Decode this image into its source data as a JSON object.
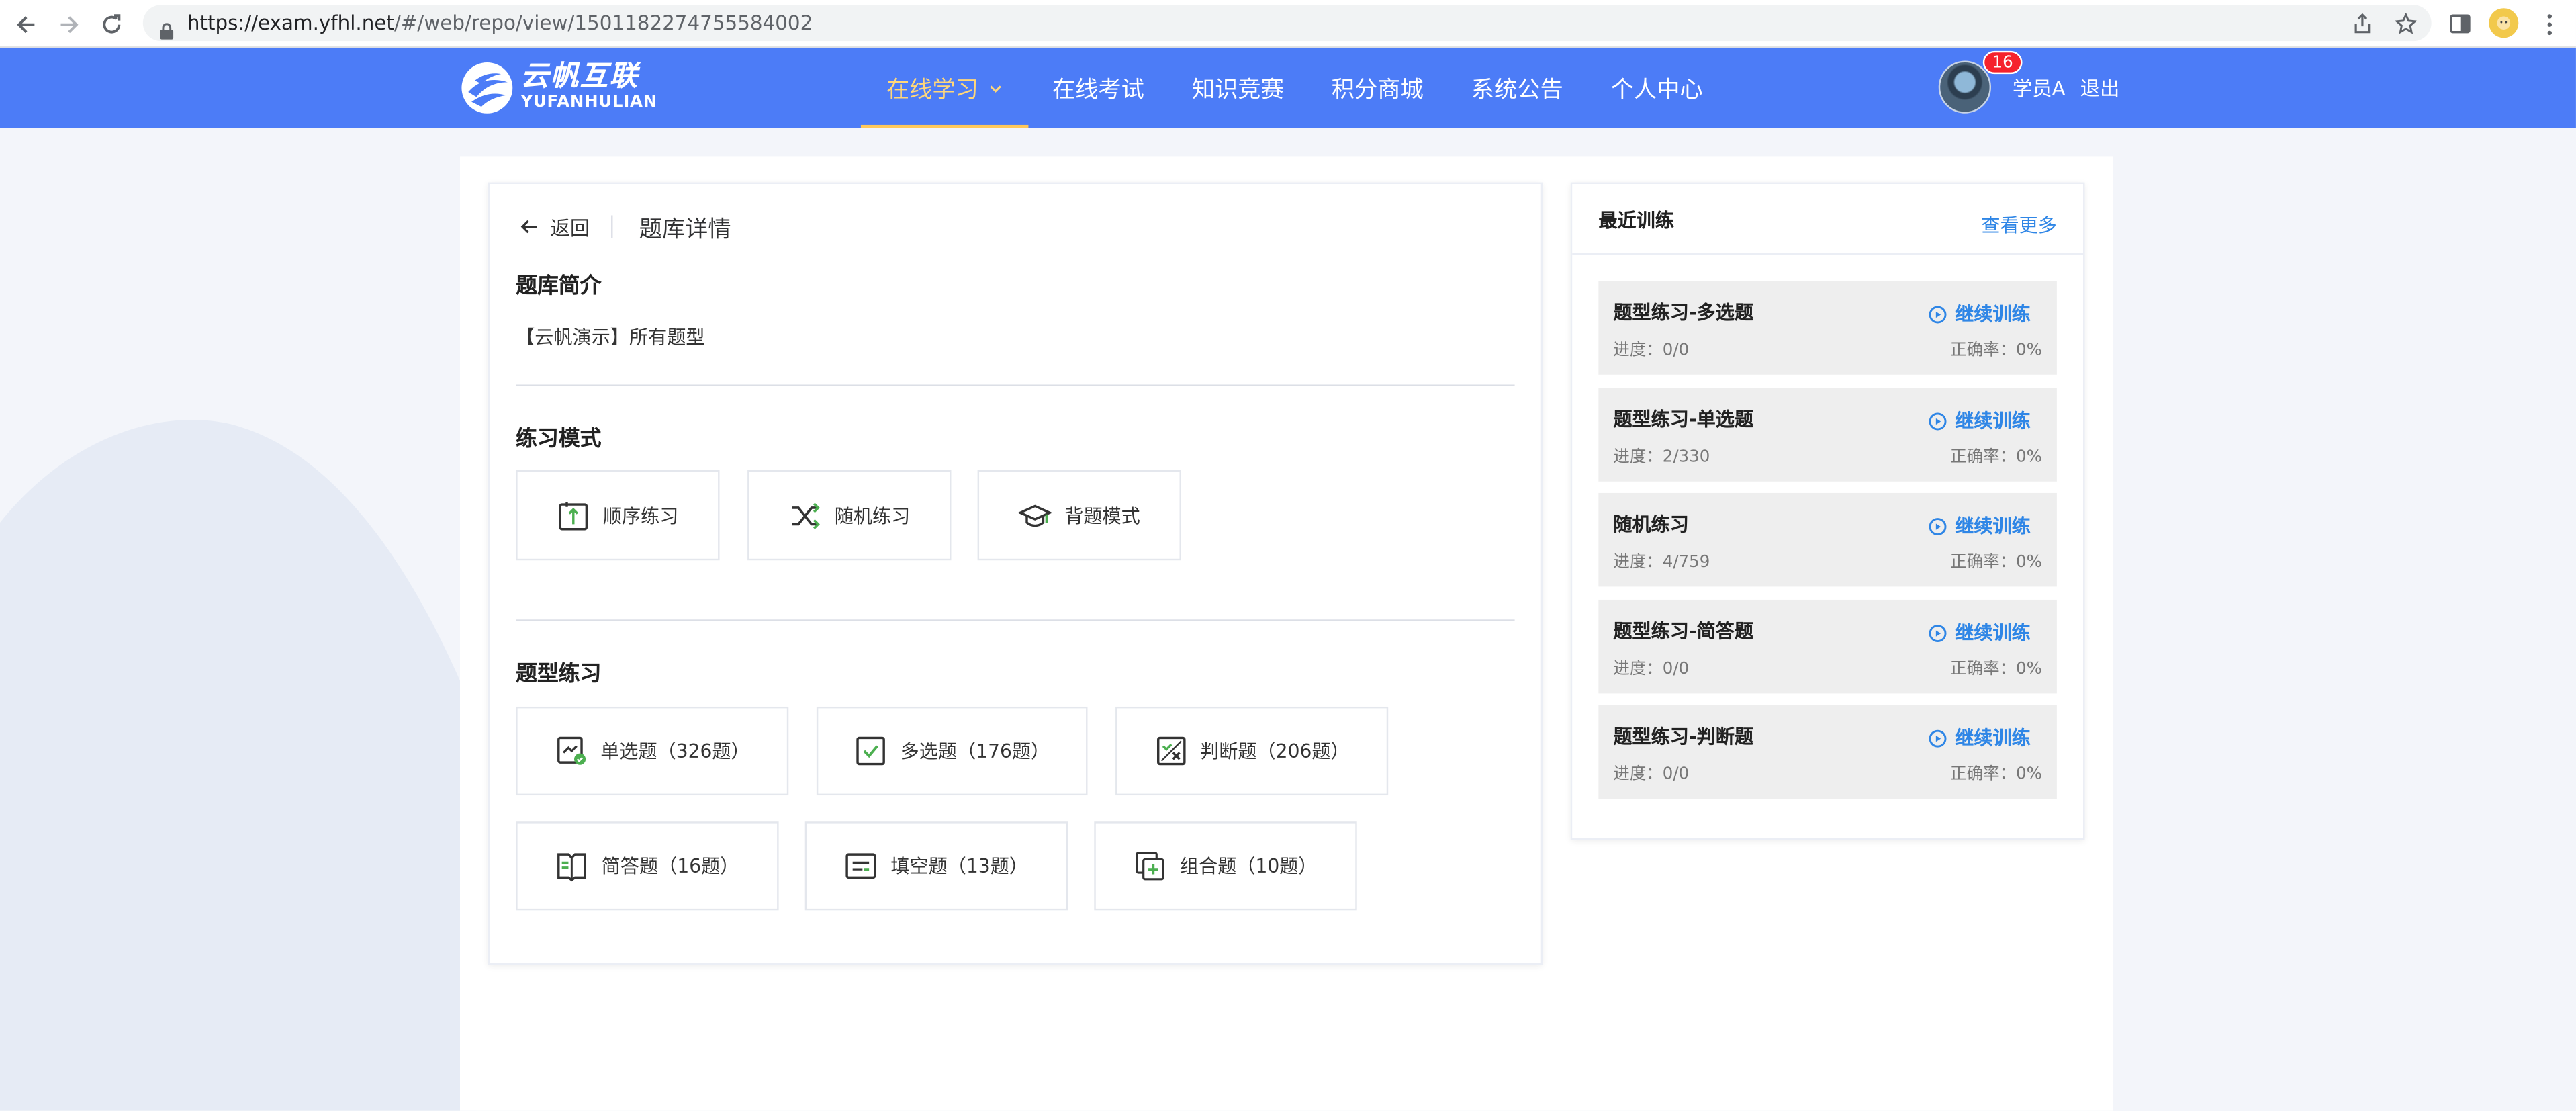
{
  "browser": {
    "url_host": "https://exam.yfhl.net",
    "url_rest": "/#/web/repo/view/1501182274755584002"
  },
  "header": {
    "logo_cn": "云帆互联",
    "logo_en": "YUFANHULIAN",
    "nav": [
      {
        "label": "在线学习",
        "active": true
      },
      {
        "label": "在线考试",
        "active": false
      },
      {
        "label": "知识竞赛",
        "active": false
      },
      {
        "label": "积分商城",
        "active": false
      },
      {
        "label": "系统公告",
        "active": false
      },
      {
        "label": "个人中心",
        "active": false
      }
    ],
    "badge_count": "16",
    "user_name": "学员A",
    "logout": "退出"
  },
  "detail": {
    "back": "返回",
    "title": "题库详情",
    "intro_title": "题库简介",
    "intro_text": "【云帆演示】所有题型",
    "mode_title": "练习模式",
    "modes": [
      {
        "label": "顺序练习",
        "icon": "sequence-icon"
      },
      {
        "label": "随机练习",
        "icon": "shuffle-icon"
      },
      {
        "label": "背题模式",
        "icon": "graduation-cap-icon"
      }
    ],
    "type_title": "题型练习",
    "types": [
      {
        "label": "单选题（326题）",
        "icon": "single-choice-icon"
      },
      {
        "label": "多选题（176题）",
        "icon": "multi-choice-icon"
      },
      {
        "label": "判断题（206题）",
        "icon": "judge-icon"
      },
      {
        "label": "简答题（16题）",
        "icon": "book-icon"
      },
      {
        "label": "填空题（13题）",
        "icon": "fill-blank-icon"
      },
      {
        "label": "组合题（10题）",
        "icon": "combo-icon"
      }
    ]
  },
  "recent": {
    "title": "最近训练",
    "more": "查看更多",
    "continue_label": "继续训练",
    "items": [
      {
        "name": "题型练习-多选题",
        "progress": "进度：0/0",
        "accuracy": "正确率：0%"
      },
      {
        "name": "题型练习-单选题",
        "progress": "进度：2/330",
        "accuracy": "正确率：0%"
      },
      {
        "name": "随机练习",
        "progress": "进度：4/759",
        "accuracy": "正确率：0%"
      },
      {
        "name": "题型练习-简答题",
        "progress": "进度：0/0",
        "accuracy": "正确率：0%"
      },
      {
        "name": "题型练习-判断题",
        "progress": "进度：0/0",
        "accuracy": "正确率：0%"
      }
    ]
  },
  "colors": {
    "header_bg": "#4c7cf7",
    "nav_active": "#ffd77a",
    "link_blue": "#2f86e6",
    "icon_green": "#4caf50"
  }
}
